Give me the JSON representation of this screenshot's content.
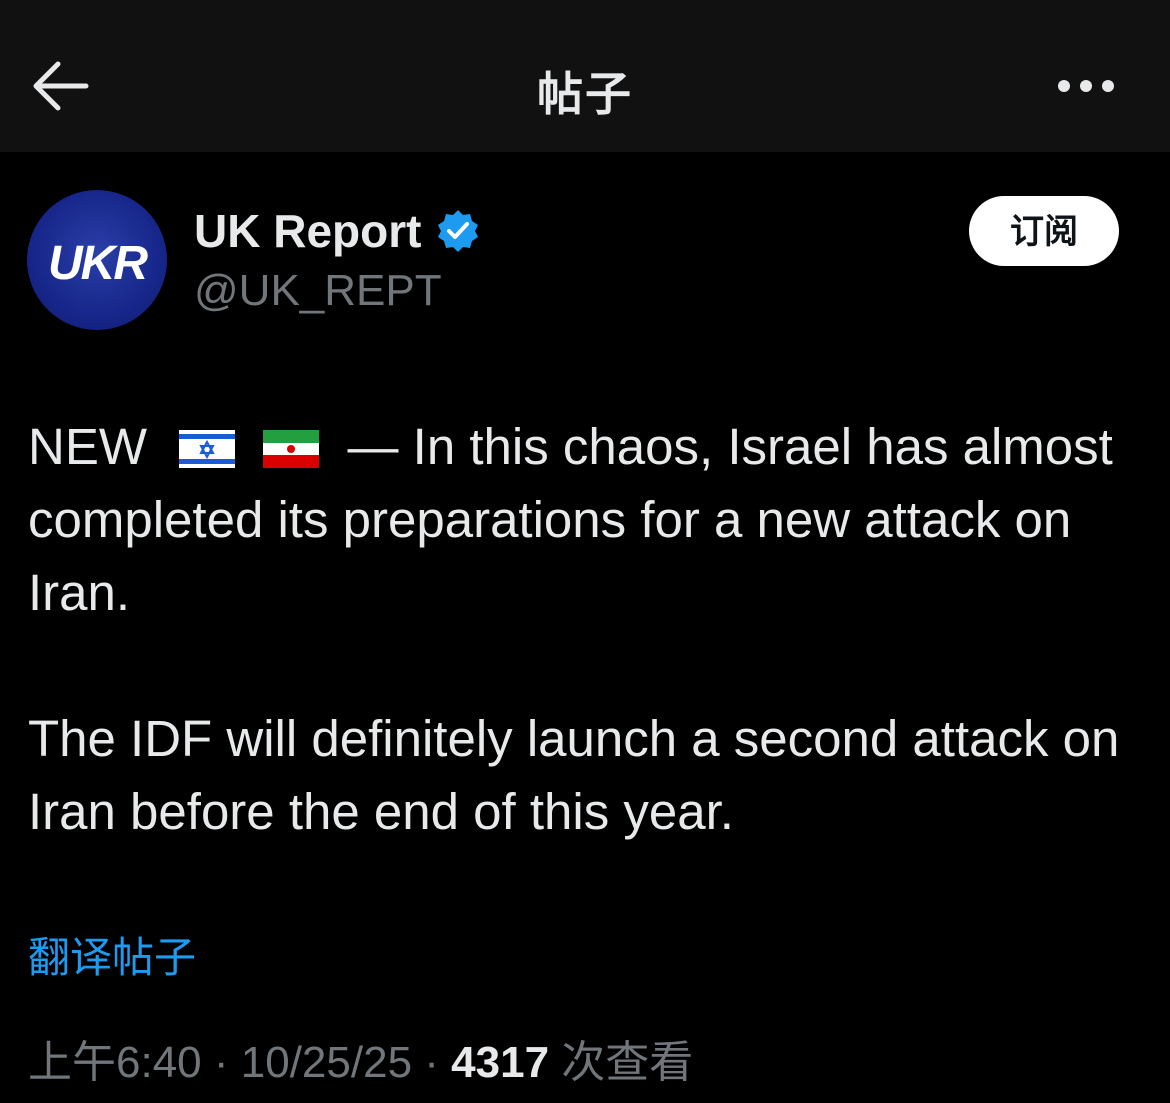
{
  "header": {
    "title": "帖子",
    "back_icon": "arrow-left-icon",
    "more_icon": "more-horizontal-icon"
  },
  "author": {
    "avatar_text": "UKR",
    "display_name": "UK Report",
    "handle": "@UK_REPT",
    "verified_icon": "verified-badge-icon",
    "verified_color": "#1d9bf0"
  },
  "subscribe_button": {
    "label": "订阅"
  },
  "post": {
    "lead": "NEW",
    "flags": [
      "israel-flag-icon",
      "iran-flag-icon"
    ],
    "line1_rest": "—  In this chaos, Israel has almost completed its preparations for a new attack on Iran.",
    "paragraph2": "The IDF will definitely launch a second attack on Iran before the end of this year."
  },
  "translate_link": {
    "label": "翻译帖子"
  },
  "meta": {
    "time": "上午6:40",
    "separator": "·",
    "date": "10/25/25",
    "views_count": "4317",
    "views_label": "次查看"
  },
  "colors": {
    "background": "#000000",
    "header_background": "#111111",
    "text_primary": "#e7e9ea",
    "text_secondary": "#71767b",
    "link": "#1d9bf0"
  }
}
